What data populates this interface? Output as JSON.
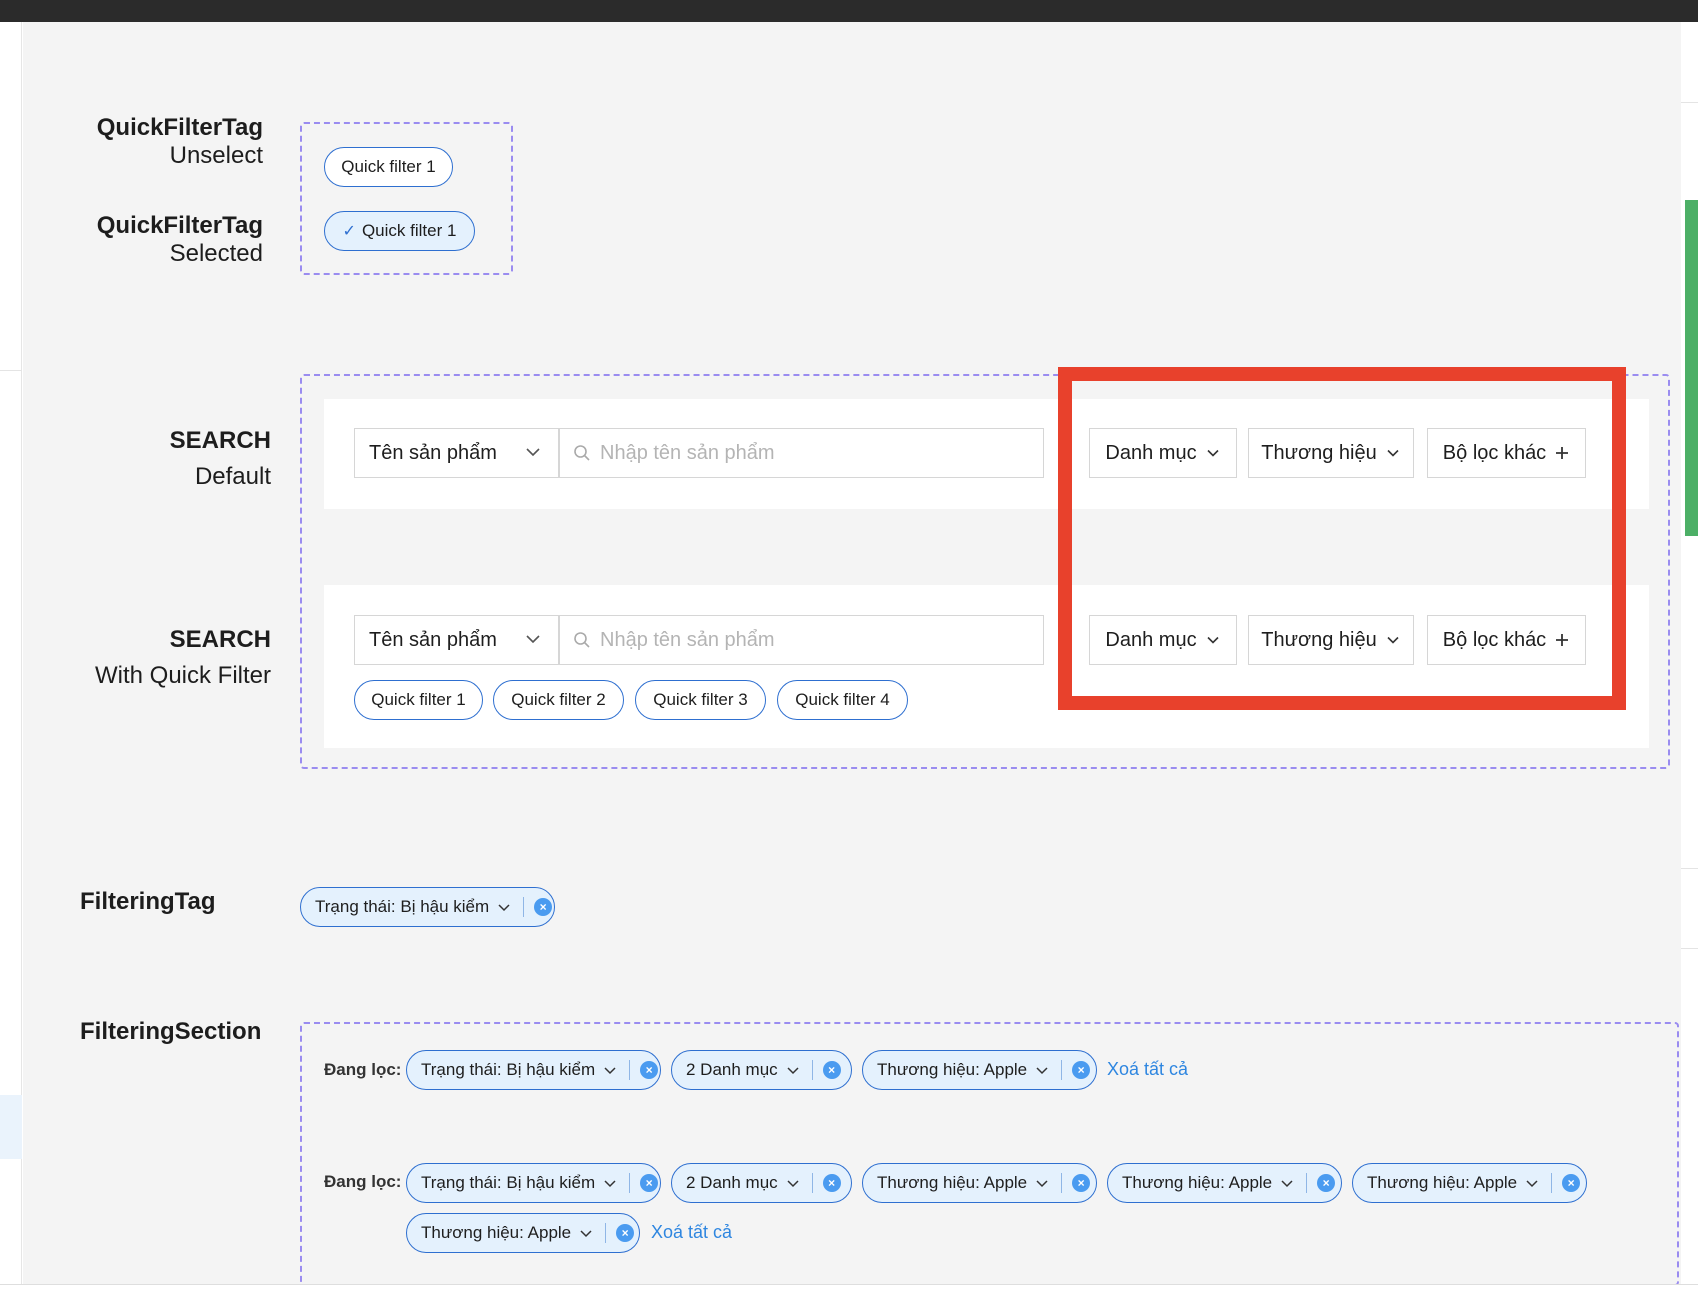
{
  "sections": {
    "quick_filter": {
      "unselect_title": "QuickFilterTag",
      "unselect_sub": "Unselect",
      "selected_title": "QuickFilterTag",
      "selected_sub": "Selected",
      "tag_unselect": "Quick filter 1",
      "tag_selected": "Quick filter 1"
    },
    "search_default": {
      "title": "SEARCH",
      "sub": "Default"
    },
    "search_quick": {
      "title": "SEARCH",
      "sub": "With Quick Filter",
      "quick_filters": [
        "Quick filter 1",
        "Quick filter 2",
        "Quick filter 3",
        "Quick filter 4"
      ]
    },
    "filtering_tag": {
      "title": "FilteringTag",
      "tag": "Trạng thái: Bị hậu kiểm"
    },
    "filtering_section": {
      "title": "FilteringSection",
      "label": "Đang lọc:",
      "row1": [
        "Trạng thái: Bị hậu kiểm",
        "2 Danh mục",
        "Thương hiệu: Apple"
      ],
      "row2": [
        "Trạng thái: Bị hậu kiểm",
        "2 Danh mục",
        "Thương hiệu: Apple",
        "Thương hiệu: Apple",
        "Thương hiệu: Apple"
      ],
      "row3": [
        "Thương hiệu: Apple"
      ],
      "clear_all": "Xoá tất cả"
    }
  },
  "search": {
    "field_select": "Tên sản phẩm",
    "placeholder": "Nhập tên sản phẩm",
    "category": "Danh mục",
    "brand": "Thương hiệu",
    "more_filters": "Bộ lọc khác"
  },
  "colors": {
    "accent": "#2e6fd0",
    "link": "#2e86e0",
    "dashed": "#9a8cf0",
    "highlight": "#e8412c"
  }
}
